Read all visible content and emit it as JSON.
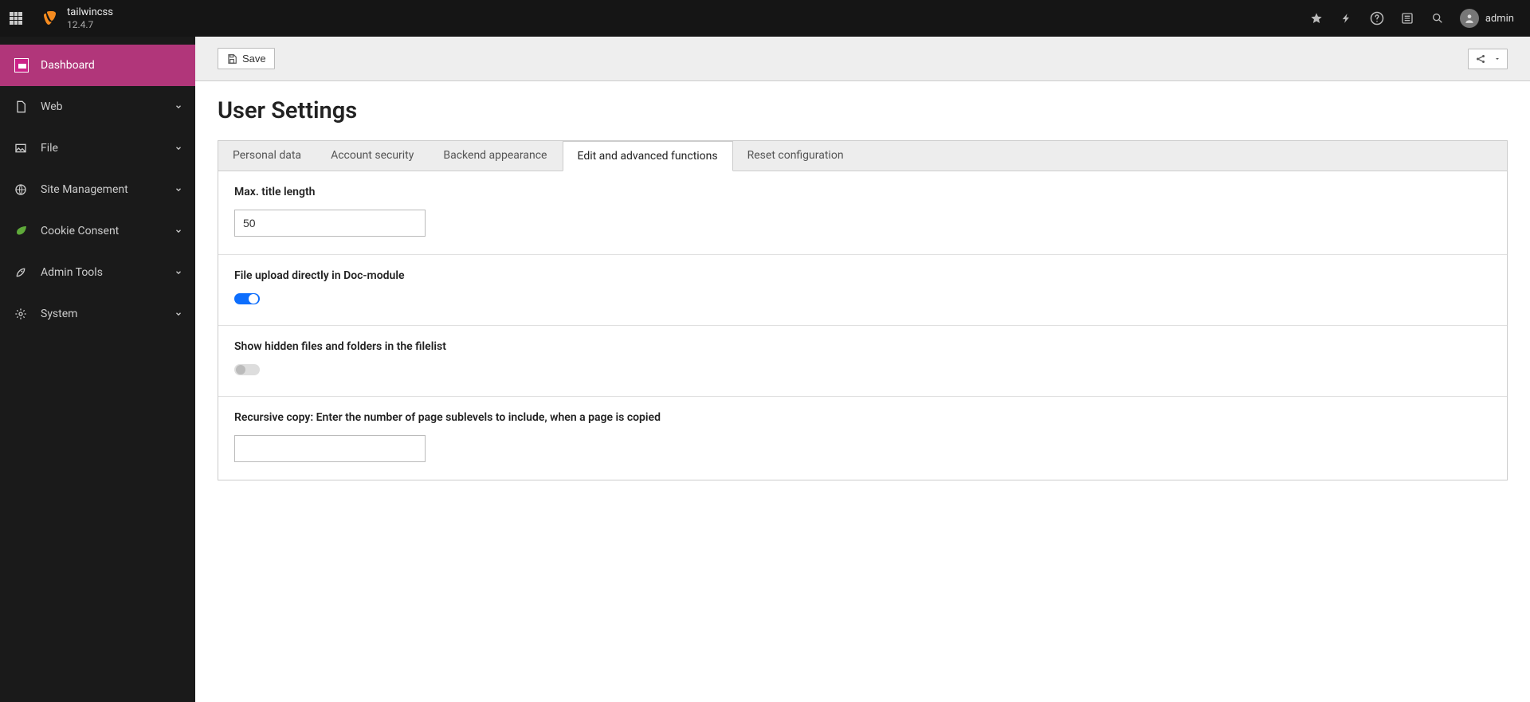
{
  "topbar": {
    "site_name": "tailwincss",
    "version": "12.4.7",
    "user_label": "admin"
  },
  "sidebar": {
    "items": [
      {
        "label": "Dashboard",
        "active": true,
        "expandable": false
      },
      {
        "label": "Web",
        "active": false,
        "expandable": true
      },
      {
        "label": "File",
        "active": false,
        "expandable": true
      },
      {
        "label": "Site Management",
        "active": false,
        "expandable": true
      },
      {
        "label": "Cookie Consent",
        "active": false,
        "expandable": true
      },
      {
        "label": "Admin Tools",
        "active": false,
        "expandable": true
      },
      {
        "label": "System",
        "active": false,
        "expandable": true
      }
    ]
  },
  "docheader": {
    "save_label": "Save"
  },
  "page": {
    "title": "User Settings"
  },
  "tabs": [
    {
      "label": "Personal data"
    },
    {
      "label": "Account security"
    },
    {
      "label": "Backend appearance"
    },
    {
      "label": "Edit and advanced functions",
      "active": true
    },
    {
      "label": "Reset configuration"
    }
  ],
  "fields": {
    "max_title_length": {
      "label": "Max. title length",
      "value": "50"
    },
    "file_upload_doc": {
      "label": "File upload directly in Doc-module",
      "checked": true
    },
    "show_hidden": {
      "label": "Show hidden files and folders in the filelist",
      "checked": false
    },
    "recursive_copy": {
      "label": "Recursive copy: Enter the number of page sublevels to include, when a page is copied",
      "value": ""
    }
  }
}
